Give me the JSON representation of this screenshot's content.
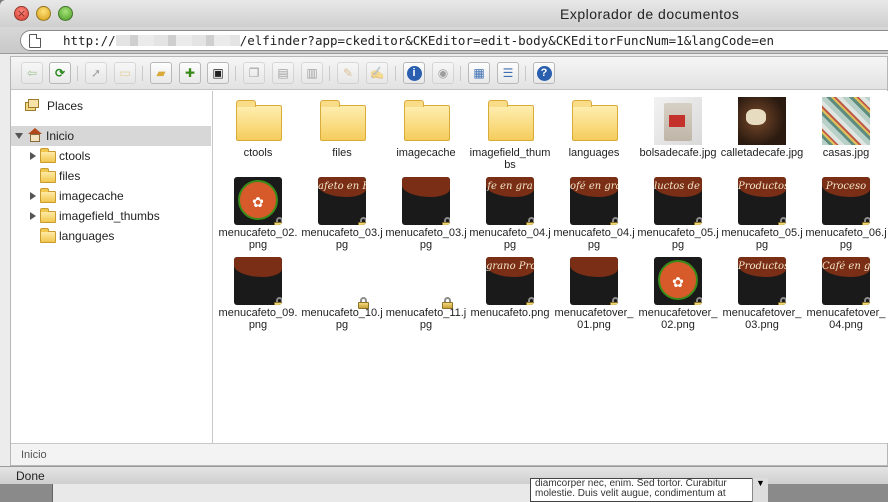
{
  "window": {
    "title": "Explorador de documentos"
  },
  "address": {
    "prefix": "http://",
    "suffix": "/elfinder?app=ckeditor&CKEditor=edit-body&CKEditorFuncNum=1&langCode=en"
  },
  "sidebar": {
    "places_label": "Places",
    "root_label": "Inicio",
    "folders": [
      {
        "label": "ctools",
        "has_children": true
      },
      {
        "label": "files",
        "has_children": false
      },
      {
        "label": "imagecache",
        "has_children": true
      },
      {
        "label": "imagefield_thumbs",
        "has_children": true
      },
      {
        "label": "languages",
        "has_children": false
      }
    ]
  },
  "items": [
    {
      "label": "ctools",
      "kind": "folder"
    },
    {
      "label": "files",
      "kind": "folder"
    },
    {
      "label": "imagecache",
      "kind": "folder"
    },
    {
      "label": "imagefield_thumbs",
      "kind": "folder"
    },
    {
      "label": "languages",
      "kind": "folder"
    },
    {
      "label": "bolsadecafe.jpg",
      "kind": "bag"
    },
    {
      "label": "calletadecafe.jpg",
      "kind": "chocolate"
    },
    {
      "label": "casas.jpg",
      "kind": "houses"
    },
    {
      "label": "menucafeto_02.png",
      "kind": "logo",
      "locked": true
    },
    {
      "label": "menucafeto_03.jpg",
      "kind": "band",
      "band_text": "afeto en F",
      "locked": true
    },
    {
      "label": "menucafeto_03.jpg",
      "kind": "band",
      "band_text": "",
      "locked": true
    },
    {
      "label": "menucafeto_04.jpg",
      "kind": "band",
      "band_text": "fe en gra",
      "locked": true
    },
    {
      "label": "menucafeto_04.jpg",
      "kind": "band",
      "band_text": "ofé en gra",
      "locked": true
    },
    {
      "label": "menucafeto_05.jpg",
      "kind": "band",
      "band_text": "luctos de C",
      "locked": true
    },
    {
      "label": "menucafeto_05.jpg",
      "kind": "band",
      "band_text": "Productos de Café",
      "locked": true
    },
    {
      "label": "menucafeto_06.jpg",
      "kind": "band",
      "band_text": "Proceso",
      "locked": true
    },
    {
      "label": "menucafeto_09.png",
      "kind": "band",
      "band_text": "",
      "locked": true
    },
    {
      "label": "menucafeto_10.jpg",
      "kind": "blank",
      "locked": true
    },
    {
      "label": "menucafeto_11.jpg",
      "kind": "blank",
      "locked": true
    },
    {
      "label": "menucafeto.png",
      "kind": "band",
      "band_text": "grano  Productos de Café",
      "locked": true
    },
    {
      "label": "menucafetover_01.png",
      "kind": "band",
      "band_text": "",
      "locked": true
    },
    {
      "label": "menucafetover_02.png",
      "kind": "logo",
      "locked": true
    },
    {
      "label": "menucafetover_03.png",
      "kind": "band",
      "band_text": "Productos de Café",
      "locked": true
    },
    {
      "label": "menucafetover_04.png",
      "kind": "band",
      "band_text": "Café en grano",
      "locked": true
    }
  ],
  "status": {
    "path": "Inicio"
  },
  "browser_status": "Done",
  "background_editor_text": "diamcorper nec, enim. Sed tortor. Curabitur molestie. Duis velit augue, condimentum at"
}
